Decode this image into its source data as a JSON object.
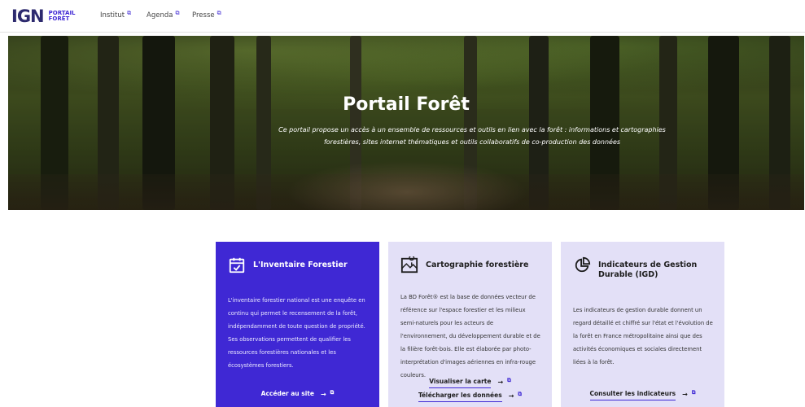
{
  "header": {
    "logo_text": "IGN",
    "logo_sub_line1": "PORTAIL",
    "logo_sub_line2": "FORÊT",
    "nav": [
      {
        "label": "Institut",
        "icon": "external-link-icon"
      },
      {
        "label": "Agenda",
        "icon": "external-link-icon"
      },
      {
        "label": "Presse",
        "icon": "external-link-icon"
      }
    ]
  },
  "hero": {
    "title": "Portail Forêt",
    "description_line1": "Ce portail propose un accès à un ensemble de ressources et outils en lien avec la forêt : informations et cartographies",
    "description_line2": "forestières, sites internet thématiques et outils collaboratifs de co-production des données"
  },
  "cards": [
    {
      "icon": "calendar-check-icon",
      "title": "L'Inventaire Forestier",
      "body": "L'inventaire forestier national est une enquête en continu qui permet le recensement de la forêt, indépendamment de toute question de propriété. Ses observations permettent de qualifier les ressources forestières nationales et les écosystèmes forestiers.",
      "links": [
        {
          "label": "Accéder au site",
          "arrow": "→",
          "icon": "external-link-icon"
        }
      ]
    },
    {
      "icon": "map-icon",
      "title": "Cartographie forestière",
      "body": "La BD Forêt® est la base de données vecteur de référence sur l'espace forestier et les milieux semi-naturels pour les acteurs de l'environnement, du développement durable et de la filière forêt-bois. Elle est élaborée par photo-interprétation d'images aériennes en infra-rouge couleurs.",
      "links": [
        {
          "label": "Visualiser la carte",
          "arrow": "→",
          "icon": "external-link-icon"
        },
        {
          "label": "Télécharger les données",
          "arrow": "→",
          "icon": "external-link-icon"
        }
      ]
    },
    {
      "icon": "pie-chart-icon",
      "title": "Indicateurs de Gestion Durable (IGD)",
      "body": "Les indicateurs de gestion durable donnent un regard détaillé et chiffré sur l'état et l'évolution de la forêt en France métropolitaine ainsi que des activités économiques et sociales directement liées à la forêt.",
      "links": [
        {
          "label": "Consulter les indicateurs",
          "arrow": "→",
          "icon": "external-link-icon"
        }
      ]
    }
  ],
  "colors": {
    "accent": "#3f28d4",
    "card_light": "#e3e0f7",
    "logo_dark": "#2d2a6e",
    "logo_green": "#6bb04f"
  }
}
